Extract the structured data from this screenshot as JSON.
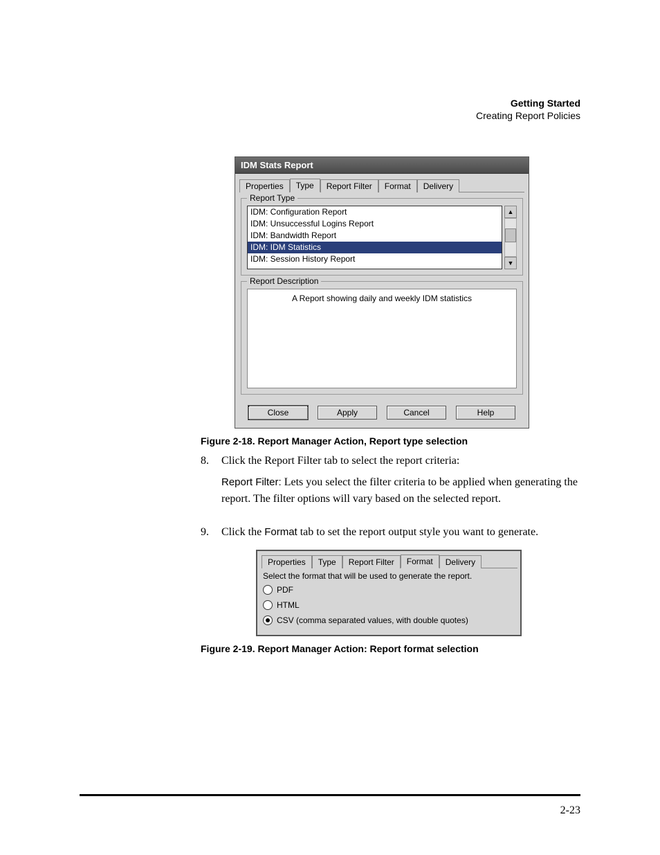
{
  "header": {
    "title": "Getting Started",
    "subtitle": "Creating Report Policies"
  },
  "figure1": {
    "window_title": "IDM Stats Report",
    "tabs": [
      "Properties",
      "Type",
      "Report Filter",
      "Format",
      "Delivery"
    ],
    "active_tab": "Type",
    "group1_legend": "Report Type",
    "list_items": [
      "IDM: Configuration Report",
      "IDM: Unsuccessful Logins Report",
      "IDM: Bandwidth Report",
      "IDM: IDM Statistics",
      "IDM: Session History Report"
    ],
    "selected_item": "IDM: IDM Statistics",
    "group2_legend": "Report Description",
    "description_text": "A Report showing daily and weekly IDM statistics",
    "buttons": {
      "close": "Close",
      "apply": "Apply",
      "cancel": "Cancel",
      "help": "Help"
    },
    "caption": "Figure 2-18. Report Manager Action, Report type selection"
  },
  "step8": {
    "num": "8.",
    "text": "Click the Report Filter tab to select the report criteria:",
    "sub_label": "Report Filter:",
    "sub_text": " Lets you select the filter criteria to be applied when generating the report. The filter options will vary based on the selected report."
  },
  "step9": {
    "num": "9.",
    "prefix": "Click the ",
    "term": "Format",
    "suffix": " tab to set the report output style you want to generate."
  },
  "figure2": {
    "tabs": [
      "Properties",
      "Type",
      "Report Filter",
      "Format",
      "Delivery"
    ],
    "active_tab": "Format",
    "prompt": "Select the format that will be used to generate the report.",
    "options": {
      "pdf": "PDF",
      "html": "HTML",
      "csv": "CSV (comma separated values, with double quotes)"
    },
    "selected": "csv",
    "caption": "Figure 2-19. Report Manager Action: Report format selection"
  },
  "page_number": "2-23",
  "chart_data": null
}
